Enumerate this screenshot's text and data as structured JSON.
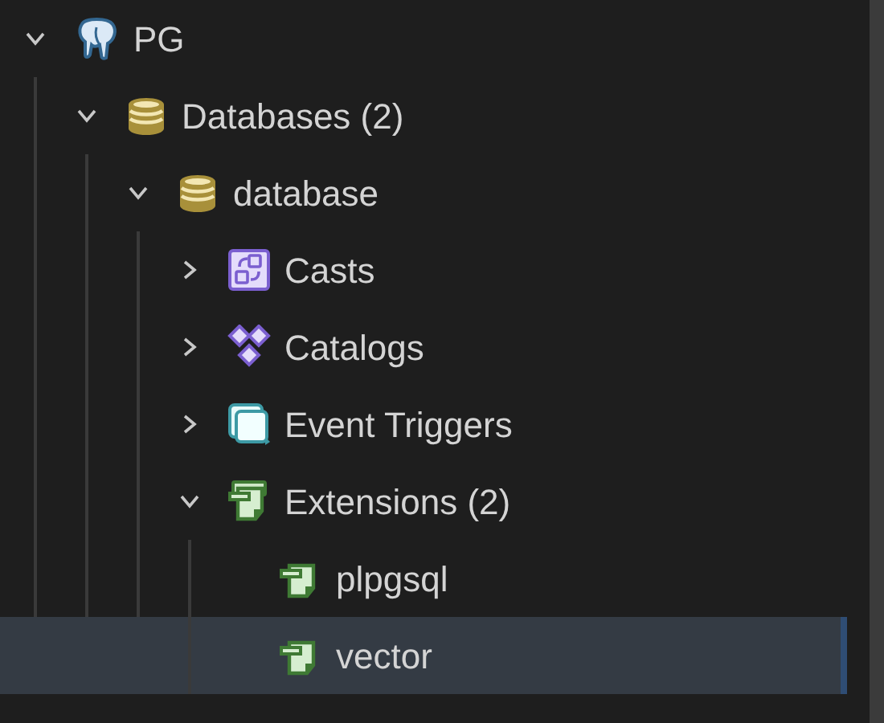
{
  "tree": [
    {
      "label": "PG",
      "kind": "server",
      "expanded": true,
      "selected": false,
      "children": [
        {
          "label": "Databases (2)",
          "kind": "databases",
          "expanded": true,
          "selected": false,
          "children": [
            {
              "label": "database",
              "kind": "database",
              "expanded": true,
              "selected": false,
              "children": [
                {
                  "label": "Casts",
                  "kind": "casts",
                  "expanded": false,
                  "selected": false
                },
                {
                  "label": "Catalogs",
                  "kind": "catalogs",
                  "expanded": false,
                  "selected": false
                },
                {
                  "label": "Event Triggers",
                  "kind": "triggers",
                  "expanded": false,
                  "selected": false
                },
                {
                  "label": "Extensions (2)",
                  "kind": "extensions",
                  "expanded": true,
                  "selected": false,
                  "children": [
                    {
                      "label": "plpgsql",
                      "kind": "extension",
                      "selected": false
                    },
                    {
                      "label": "vector",
                      "kind": "extension",
                      "selected": true
                    }
                  ]
                }
              ]
            }
          ]
        }
      ]
    }
  ]
}
